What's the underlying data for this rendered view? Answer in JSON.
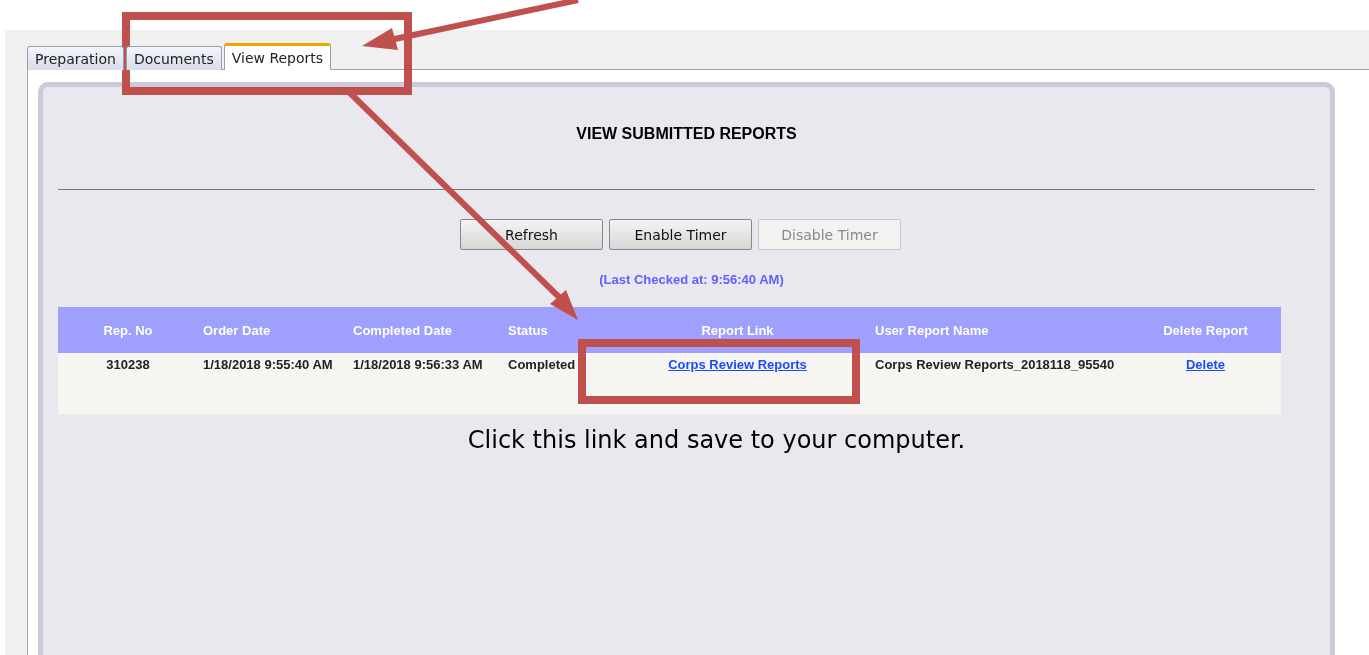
{
  "tabs": [
    {
      "label": "Preparation",
      "selected": false
    },
    {
      "label": "Documents",
      "selected": false
    },
    {
      "label": "View Reports",
      "selected": true
    }
  ],
  "title": "VIEW SUBMITTED REPORTS",
  "buttons": [
    {
      "label": "Refresh",
      "disabled": false
    },
    {
      "label": "Enable Timer",
      "disabled": false
    },
    {
      "label": "Disable Timer",
      "disabled": true
    }
  ],
  "last_checked": "(Last Checked at: 9:56:40 AM)",
  "table": {
    "columns": [
      {
        "label": "Rep. No"
      },
      {
        "label": "Order Date"
      },
      {
        "label": "Completed Date"
      },
      {
        "label": "Status"
      },
      {
        "label": "Report Link"
      },
      {
        "label": "User Report Name"
      },
      {
        "label": "Delete Report"
      }
    ],
    "rows": [
      {
        "cells": [
          {
            "kind": "text",
            "text": "310238"
          },
          {
            "kind": "text",
            "text": "1/18/2018 9:55:40 AM"
          },
          {
            "kind": "text",
            "text": "1/18/2018 9:56:33 AM"
          },
          {
            "kind": "text",
            "text": "Completed"
          },
          {
            "kind": "link",
            "text": "Corps Review Reports"
          },
          {
            "kind": "text",
            "text": "Corps Review Reports_2018118_95540"
          },
          {
            "kind": "link",
            "text": "Delete"
          }
        ]
      }
    ]
  },
  "annotation": "Click this link and save to your computer."
}
